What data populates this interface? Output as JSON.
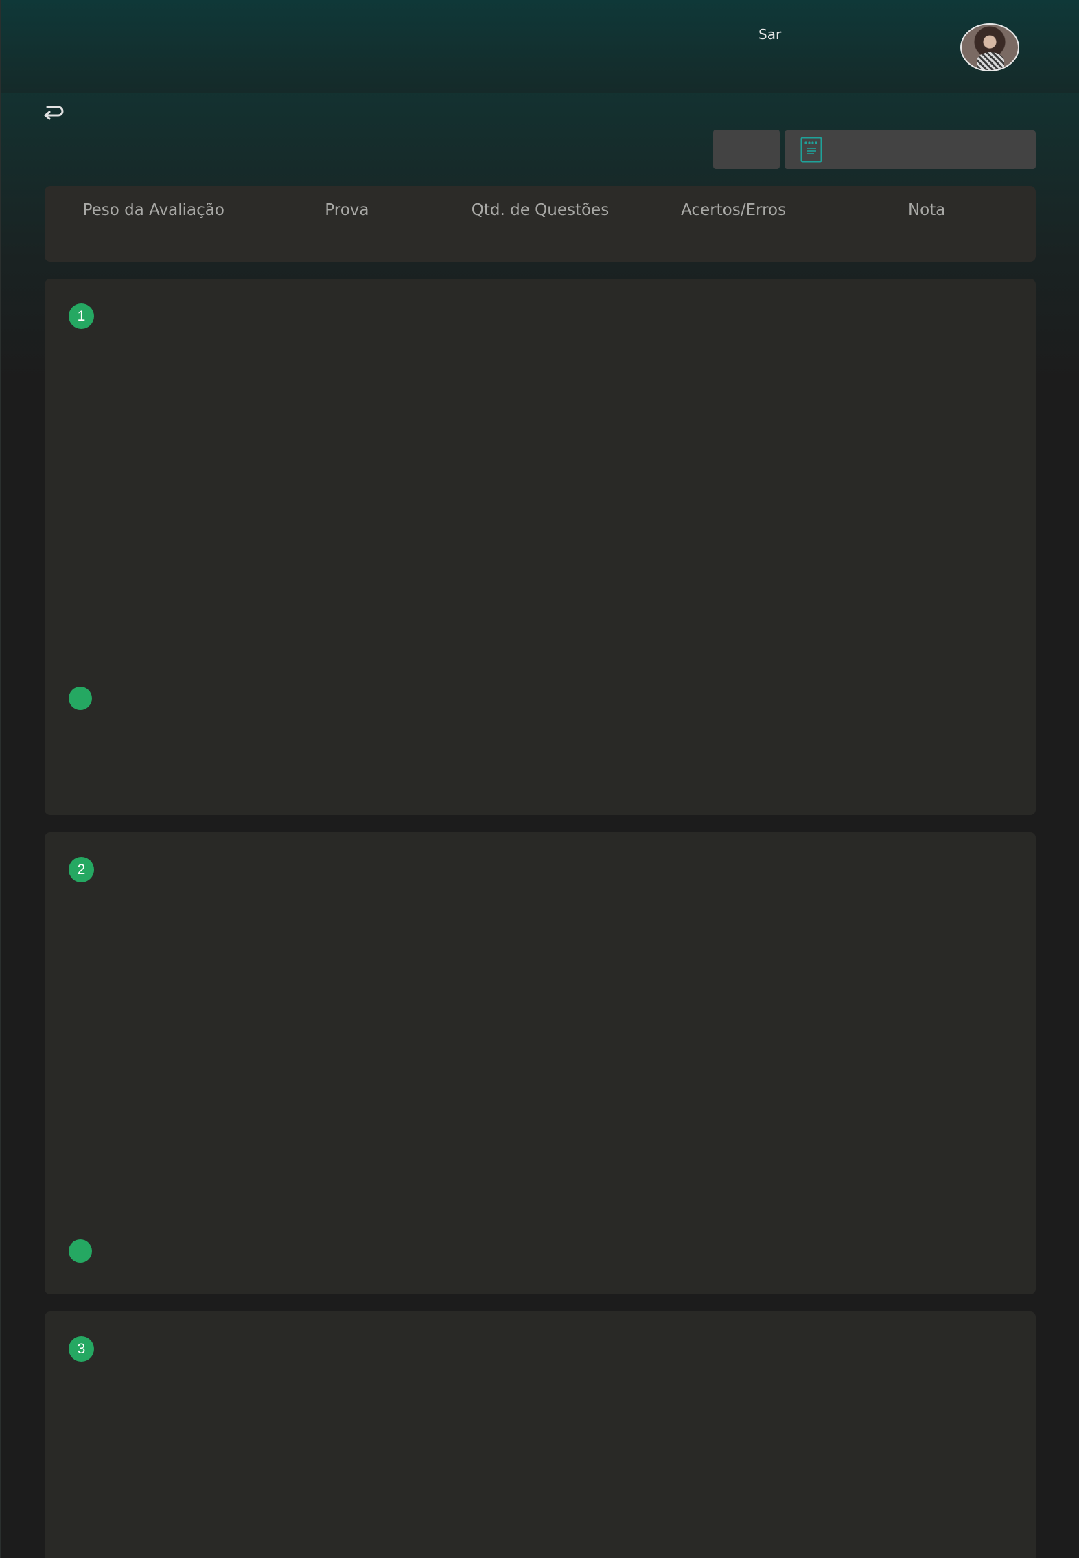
{
  "header": {
    "user_name": "Sar"
  },
  "results_table": {
    "columns": [
      "Peso da Avaliação",
      "Prova",
      "Qtd. de Questões",
      "Acertos/Erros",
      "Nota"
    ]
  },
  "questions": [
    {
      "number": "1"
    },
    {
      "number": "2"
    },
    {
      "number": "3"
    }
  ],
  "icons": {
    "back": "return-arrow-icon",
    "document": "document-icon"
  },
  "colors": {
    "accent_green": "#25a862",
    "icon_teal": "#1fa29a",
    "card_bg": "#292926",
    "header_gradient_top": "#0f3838"
  }
}
